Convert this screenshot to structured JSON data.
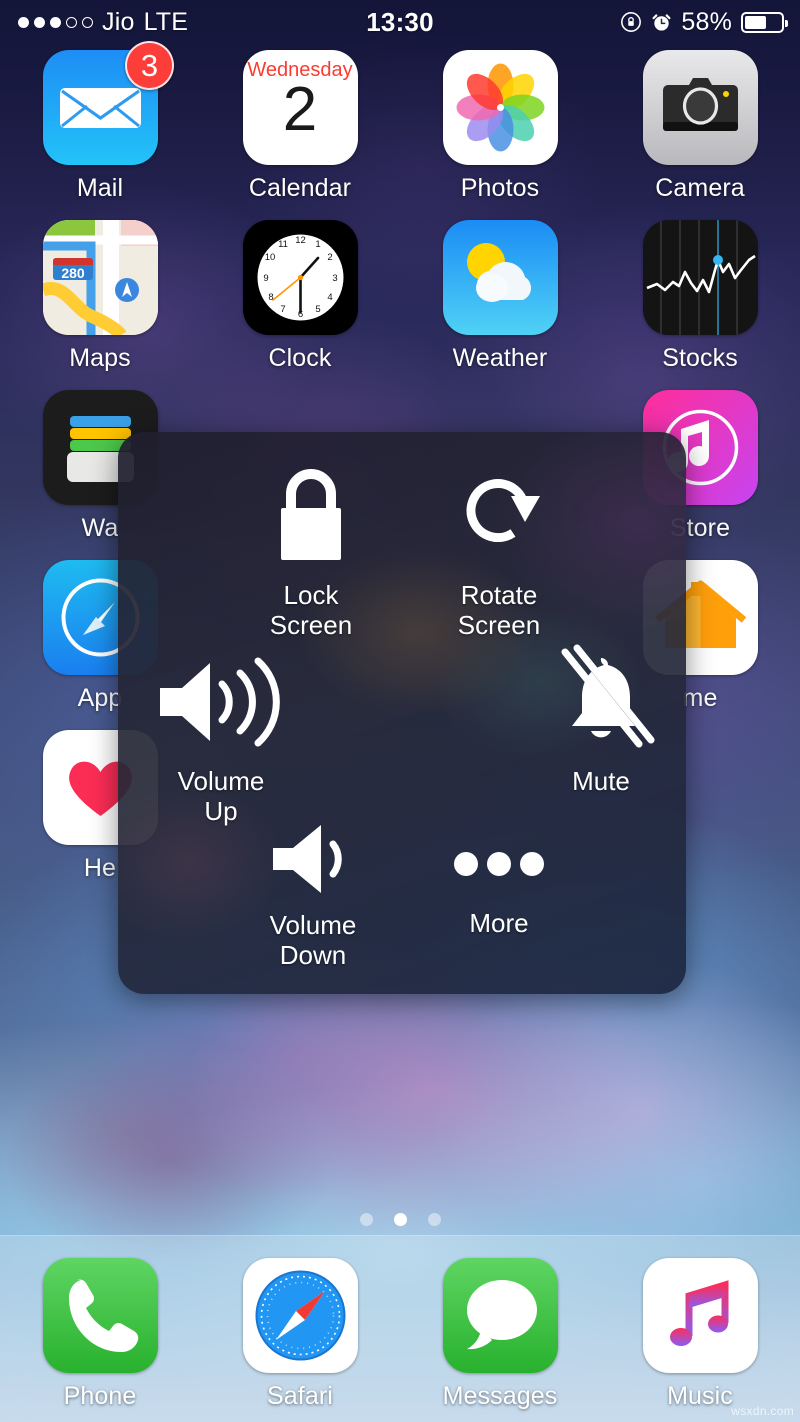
{
  "status_bar": {
    "signal_dots_filled": 3,
    "signal_dots_total": 5,
    "carrier": "Jio",
    "network": "LTE",
    "time": "13:30",
    "rotation_lock_icon": "rotation-lock-icon",
    "alarm_icon": "alarm-clock-icon",
    "battery_percent": "58%",
    "battery_level": 58
  },
  "home_screen": {
    "rows": [
      [
        {
          "name": "Mail",
          "icon": "mail-icon",
          "badge": "3"
        },
        {
          "name": "Calendar",
          "icon": "calendar-icon",
          "day": "Wednesday",
          "date": "2"
        },
        {
          "name": "Photos",
          "icon": "photos-icon"
        },
        {
          "name": "Camera",
          "icon": "camera-icon"
        }
      ],
      [
        {
          "name": "Maps",
          "icon": "maps-icon",
          "route_shield": "280"
        },
        {
          "name": "Clock",
          "icon": "clock-icon"
        },
        {
          "name": "Weather",
          "icon": "weather-icon"
        },
        {
          "name": "Stocks",
          "icon": "stocks-icon"
        }
      ],
      [
        {
          "name": "Wa",
          "full_name": "Wallet",
          "icon": "wallet-icon"
        },
        {
          "name": "",
          "icon": "hidden-icon"
        },
        {
          "name": "",
          "icon": "hidden-icon"
        },
        {
          "name": "Store",
          "full_name": "iTunes Store",
          "icon": "itunes-store-icon"
        }
      ],
      [
        {
          "name": "App",
          "full_name": "App Store",
          "icon": "app-store-icon"
        },
        {
          "name": "",
          "icon": "hidden-icon"
        },
        {
          "name": "",
          "icon": "hidden-icon"
        },
        {
          "name": "me",
          "full_name": "Home",
          "icon": "home-app-icon"
        }
      ],
      [
        {
          "name": "He",
          "full_name": "Health",
          "icon": "health-icon"
        },
        {
          "name": "",
          "icon": "hidden-icon"
        },
        {
          "name": "",
          "icon": "hidden-icon"
        },
        {
          "name": "",
          "icon": "hidden-icon"
        }
      ]
    ]
  },
  "assistive_touch": {
    "items": [
      {
        "id": "lock-screen",
        "label": "Lock\nScreen",
        "label_line1": "Lock",
        "label_line2": "Screen",
        "icon": "padlock-icon"
      },
      {
        "id": "rotate-screen",
        "label": "Rotate\nScreen",
        "label_line1": "Rotate",
        "label_line2": "Screen",
        "icon": "rotate-icon"
      },
      {
        "id": "volume-up",
        "label": "Volume\nUp",
        "label_line1": "Volume",
        "label_line2": "Up",
        "icon": "speaker-waves-icon"
      },
      {
        "id": "mute",
        "label": "Mute",
        "label_line1": "Mute",
        "label_line2": "",
        "icon": "bell-slash-icon"
      },
      {
        "id": "volume-down",
        "label": "Volume\nDown",
        "label_line1": "Volume",
        "label_line2": "Down",
        "icon": "speaker-wave-icon"
      },
      {
        "id": "more",
        "label": "More",
        "label_line1": "More",
        "label_line2": "",
        "icon": "three-dots-icon"
      }
    ],
    "back_icon": "back-arrow-icon"
  },
  "page_indicator": {
    "total": 3,
    "active_index": 1
  },
  "dock": {
    "items": [
      {
        "name": "Phone",
        "icon": "phone-icon"
      },
      {
        "name": "Safari",
        "icon": "compass-icon"
      },
      {
        "name": "Messages",
        "icon": "speech-bubble-icon"
      },
      {
        "name": "Music",
        "icon": "music-note-icon"
      }
    ]
  },
  "watermark": "wsxdn.com",
  "colors": {
    "badge_red": "#fc3d39",
    "calendar_red": "#fb3b30",
    "panel_bg": "#24263a",
    "accent_white": "#ffffff"
  }
}
